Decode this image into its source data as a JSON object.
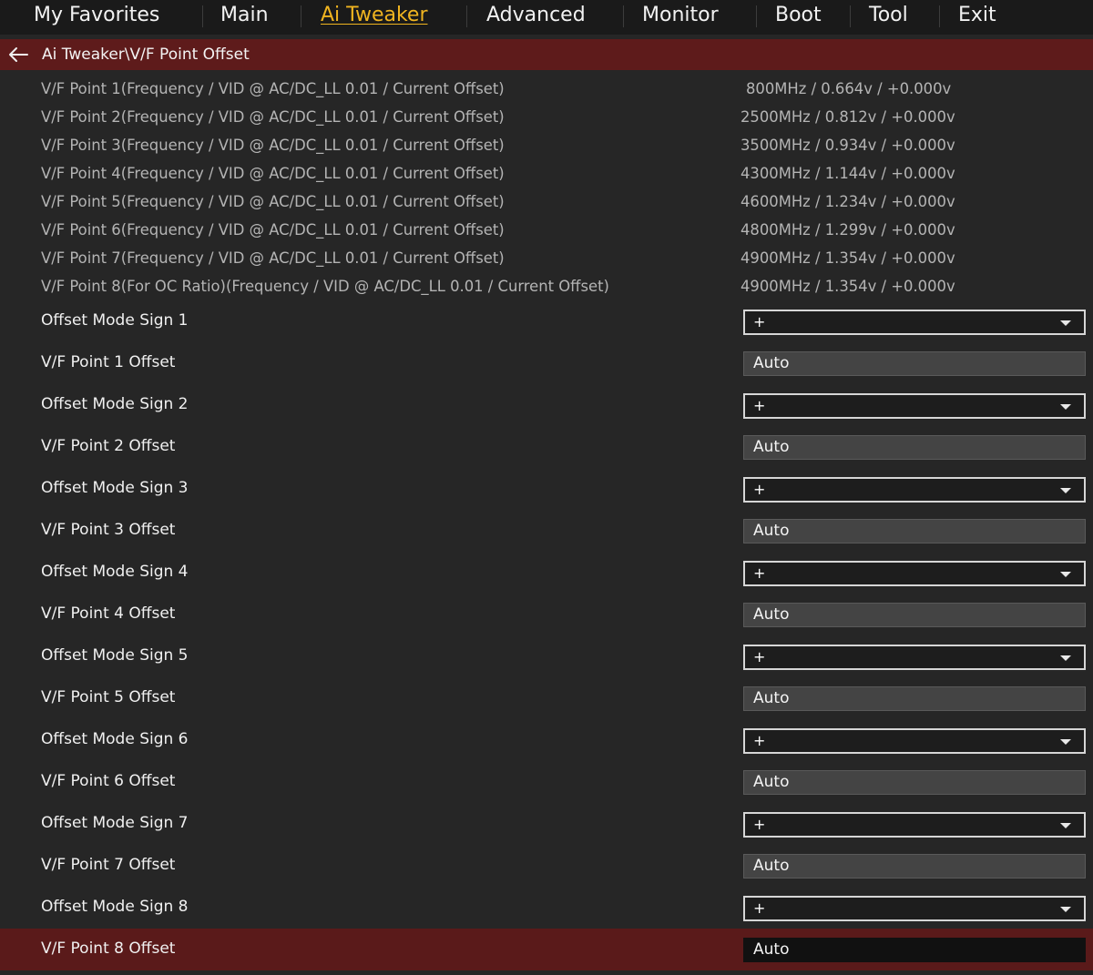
{
  "nav": {
    "tabs": [
      "My Favorites",
      "Main",
      "Ai Tweaker",
      "Advanced",
      "Monitor",
      "Boot",
      "Tool",
      "Exit"
    ],
    "active": "Ai Tweaker"
  },
  "breadcrumb": {
    "text": "Ai Tweaker\\V/F Point Offset"
  },
  "vf_points": [
    {
      "label": "V/F Point 1(Frequency / VID @ AC/DC_LL 0.01 / Current Offset)",
      "value": "800MHz / 0.664v / +0.000v"
    },
    {
      "label": "V/F Point 2(Frequency / VID @ AC/DC_LL 0.01 / Current Offset)",
      "value": "2500MHz / 0.812v / +0.000v"
    },
    {
      "label": "V/F Point 3(Frequency / VID @ AC/DC_LL 0.01 / Current Offset)",
      "value": "3500MHz / 0.934v / +0.000v"
    },
    {
      "label": "V/F Point 4(Frequency / VID @ AC/DC_LL 0.01 / Current Offset)",
      "value": "4300MHz / 1.144v / +0.000v"
    },
    {
      "label": "V/F Point 5(Frequency / VID @ AC/DC_LL 0.01 / Current Offset)",
      "value": "4600MHz / 1.234v / +0.000v"
    },
    {
      "label": "V/F Point 6(Frequency / VID @ AC/DC_LL 0.01 / Current Offset)",
      "value": "4800MHz / 1.299v / +0.000v"
    },
    {
      "label": "V/F Point 7(Frequency / VID @ AC/DC_LL 0.01 / Current Offset)",
      "value": "4900MHz / 1.354v / +0.000v"
    },
    {
      "label": "V/F Point 8(For OC Ratio)(Frequency / VID @ AC/DC_LL 0.01 / Current Offset)",
      "value": "4900MHz / 1.354v / +0.000v"
    }
  ],
  "settings": [
    {
      "label": "Offset Mode Sign 1",
      "type": "select",
      "value": "+"
    },
    {
      "label": "V/F Point 1 Offset",
      "type": "text",
      "value": "Auto"
    },
    {
      "label": "Offset Mode Sign 2",
      "type": "select",
      "value": "+"
    },
    {
      "label": "V/F Point 2 Offset",
      "type": "text",
      "value": "Auto"
    },
    {
      "label": "Offset Mode Sign 3",
      "type": "select",
      "value": "+"
    },
    {
      "label": "V/F Point 3 Offset",
      "type": "text",
      "value": "Auto"
    },
    {
      "label": "Offset Mode Sign 4",
      "type": "select",
      "value": "+"
    },
    {
      "label": "V/F Point 4 Offset",
      "type": "text",
      "value": "Auto"
    },
    {
      "label": "Offset Mode Sign 5",
      "type": "select",
      "value": "+"
    },
    {
      "label": "V/F Point 5 Offset",
      "type": "text",
      "value": "Auto"
    },
    {
      "label": "Offset Mode Sign 6",
      "type": "select",
      "value": "+"
    },
    {
      "label": "V/F Point 6 Offset",
      "type": "text",
      "value": "Auto"
    },
    {
      "label": "Offset Mode Sign 7",
      "type": "select",
      "value": "+"
    },
    {
      "label": "V/F Point 7 Offset",
      "type": "text",
      "value": "Auto"
    },
    {
      "label": "Offset Mode Sign 8",
      "type": "select",
      "value": "+"
    },
    {
      "label": "V/F Point 8 Offset",
      "type": "text",
      "value": "Auto",
      "selected": true
    }
  ],
  "colors": {
    "accent": "#f0b420",
    "header_bar": "#5e1b1b",
    "background": "#262626"
  }
}
